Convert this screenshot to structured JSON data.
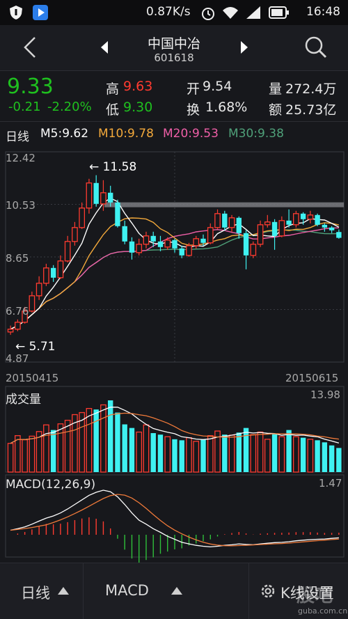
{
  "status": {
    "speed": "0.87K/s",
    "time": "16:48"
  },
  "header": {
    "name": "中国中冶",
    "code": "601618"
  },
  "quote": {
    "price": "9.33",
    "change": "-0.21",
    "change_pct": "-2.20%",
    "high_label": "高",
    "high": "9.63",
    "low_label": "低",
    "low": "9.30",
    "open_label": "开",
    "open": "9.54",
    "turnover_label": "换",
    "turnover": "1.68%",
    "volume_label": "量",
    "volume": "272.4万",
    "amount_label": "额",
    "amount": "25.73亿"
  },
  "ma_legend": {
    "period": "日线",
    "m5": "M5:9.62",
    "m10": "M10:9.78",
    "m20": "M20:9.53",
    "m30": "M30:9.38"
  },
  "price_axis": [
    "12.42",
    "10.53",
    "8.65",
    "6.76",
    "4.87"
  ],
  "annotations": {
    "max": "← 11.58",
    "min": "← 5.71"
  },
  "dates": {
    "start": "20150415",
    "end": "20150615"
  },
  "volume_panel": {
    "title": "成交量",
    "max": "13.98"
  },
  "macd_panel": {
    "title": "MACD(12,26,9)",
    "max": "1.47"
  },
  "bottom_tabs": [
    "日线",
    "MACD",
    "K线设置"
  ],
  "watermark": "股吧",
  "watermark_url": "guba.com.cn",
  "colors": {
    "up": "#ff3b30",
    "down": "#3ff1f1",
    "m5": "#ffffff",
    "m10": "#f3a93b",
    "m20": "#ef5fa7",
    "m30": "#4fa079"
  },
  "chart_data": {
    "type": "candlestick",
    "candles": [
      [
        5.95,
        6.05,
        6.18,
        5.85
      ],
      [
        6.05,
        6.3,
        6.4,
        5.98
      ],
      [
        6.3,
        6.7,
        6.85,
        6.25
      ],
      [
        6.7,
        7.25,
        7.4,
        6.65
      ],
      [
        7.25,
        7.7,
        7.95,
        7.1
      ],
      [
        7.7,
        8.25,
        8.4,
        7.6
      ],
      [
        8.25,
        7.9,
        8.35,
        7.75
      ],
      [
        7.9,
        8.5,
        8.7,
        7.85
      ],
      [
        8.5,
        9.2,
        9.4,
        8.45
      ],
      [
        9.2,
        9.7,
        9.9,
        9.05
      ],
      [
        9.7,
        10.4,
        10.6,
        9.65
      ],
      [
        10.4,
        11.3,
        11.45,
        10.2
      ],
      [
        11.3,
        10.55,
        11.58,
        10.45
      ],
      [
        10.55,
        10.95,
        11.4,
        10.3
      ],
      [
        10.95,
        10.6,
        11.2,
        10.45
      ],
      [
        10.6,
        9.75,
        10.7,
        9.7
      ],
      [
        9.75,
        9.2,
        9.95,
        9.1
      ],
      [
        9.2,
        8.8,
        9.35,
        8.55
      ],
      [
        8.8,
        9.1,
        9.3,
        8.7
      ],
      [
        9.1,
        9.4,
        9.55,
        8.95
      ],
      [
        9.4,
        9.2,
        9.55,
        9.0
      ],
      [
        9.2,
        9.0,
        9.4,
        8.85
      ],
      [
        9.0,
        9.25,
        9.35,
        8.9
      ],
      [
        9.25,
        8.95,
        9.3,
        8.8
      ],
      [
        8.95,
        8.7,
        9.05,
        8.6
      ],
      [
        8.7,
        9.05,
        9.15,
        8.65
      ],
      [
        9.05,
        9.3,
        9.4,
        8.95
      ],
      [
        9.3,
        9.15,
        9.45,
        9.05
      ],
      [
        9.15,
        9.7,
        9.85,
        9.1
      ],
      [
        9.7,
        10.2,
        10.35,
        9.65
      ],
      [
        10.2,
        9.7,
        10.3,
        9.6
      ],
      [
        9.7,
        10.05,
        10.15,
        9.55
      ],
      [
        10.05,
        9.5,
        10.1,
        9.3
      ],
      [
        9.5,
        8.7,
        9.6,
        8.2
      ],
      [
        8.7,
        9.1,
        9.2,
        8.6
      ],
      [
        9.1,
        9.8,
        9.95,
        9.0
      ],
      [
        9.8,
        9.9,
        10.15,
        9.7
      ],
      [
        9.9,
        9.4,
        10.0,
        8.9
      ],
      [
        9.4,
        9.95,
        10.1,
        9.35
      ],
      [
        9.95,
        9.8,
        10.35,
        9.7
      ],
      [
        9.8,
        10.2,
        10.3,
        9.7
      ],
      [
        10.2,
        10.0,
        10.25,
        9.8
      ],
      [
        10.0,
        10.15,
        10.3,
        9.85
      ],
      [
        10.15,
        9.8,
        10.2,
        9.75
      ],
      [
        9.8,
        9.7,
        9.85,
        9.55
      ],
      [
        9.7,
        9.6,
        9.75,
        9.5
      ],
      [
        9.54,
        9.33,
        9.63,
        9.3
      ]
    ],
    "resistance": 10.53,
    "price_high": 12.42,
    "price_low": 4.87,
    "volumes": [
      5.6,
      7.1,
      6.3,
      7.0,
      7.9,
      9.2,
      8.2,
      9.4,
      10.1,
      11.2,
      11.6,
      12.4,
      12.2,
      13.1,
      13.98,
      11.6,
      9.3,
      8.6,
      7.8,
      9.2,
      7.6,
      7.3,
      6.9,
      6.4,
      6.2,
      6.7,
      6.0,
      6.4,
      7.1,
      8.0,
      7.3,
      7.2,
      7.7,
      8.6,
      7.3,
      7.8,
      6.4,
      7.4,
      6.9,
      8.2,
      6.9,
      6.7,
      6.4,
      6.2,
      5.8,
      5.2,
      4.7
    ],
    "macd": [
      0.15,
      0.2,
      0.26,
      0.35,
      0.45,
      0.55,
      0.62,
      0.72,
      0.85,
      1.0,
      1.15,
      1.3,
      1.4,
      1.47,
      1.42,
      1.25,
      1.0,
      0.72,
      0.48,
      0.35,
      0.2,
      0.08,
      -0.05,
      -0.15,
      -0.25,
      -0.3,
      -0.35,
      -0.38,
      -0.4,
      -0.38,
      -0.35,
      -0.33,
      -0.3,
      -0.32,
      -0.33,
      -0.3,
      -0.28,
      -0.26,
      -0.25,
      -0.23,
      -0.2,
      -0.18,
      -0.16,
      -0.15,
      -0.14,
      -0.12,
      -0.1
    ]
  }
}
